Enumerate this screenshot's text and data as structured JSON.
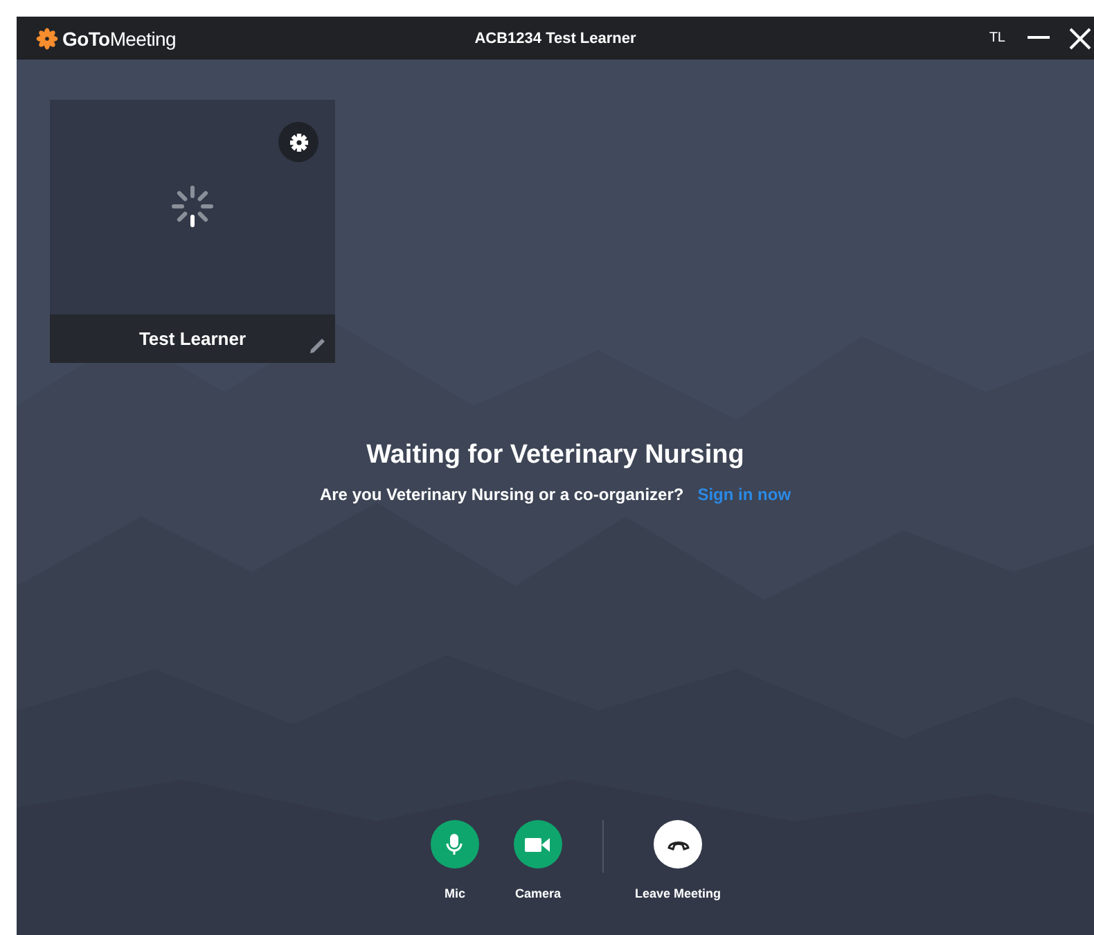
{
  "window": {
    "logo": "**GoTo**Meeting",
    "title": "ACB1234 Test Learner",
    "initials": "TL"
  },
  "tile": {
    "name": "Test Learner"
  },
  "waiting": {
    "heading": "Waiting for Veterinary Nursing",
    "question": "Are you Veterinary Nursing or a co-organizer?",
    "link": "Sign in now"
  },
  "controls": [
    {
      "kind": "mic",
      "label": "Mic"
    },
    {
      "kind": "camera",
      "label": "Camera"
    },
    {
      "kind": "leave",
      "label": "Leave Meeting"
    }
  ]
}
